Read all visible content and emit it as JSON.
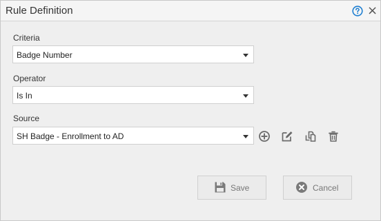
{
  "dialog": {
    "title": "Rule Definition",
    "help_icon": "question-circle-icon",
    "close_icon": "close-icon",
    "close_glyph": "×"
  },
  "form": {
    "criteria": {
      "label": "Criteria",
      "value": "Badge Number"
    },
    "operator": {
      "label": "Operator",
      "value": "Is In"
    },
    "source": {
      "label": "Source",
      "value": "SH Badge - Enrollment to AD"
    }
  },
  "source_tools": [
    "add-circle-icon",
    "edit-icon",
    "copy-icon",
    "trash-icon"
  ],
  "footer": {
    "save_label": "Save",
    "save_icon": "floppy-disk-icon",
    "cancel_label": "Cancel",
    "cancel_icon": "cancel-circle-icon"
  },
  "colors": {
    "accent": "#1f7fd1",
    "icon_gray": "#6b6b6b",
    "disabled_text": "#777777"
  }
}
